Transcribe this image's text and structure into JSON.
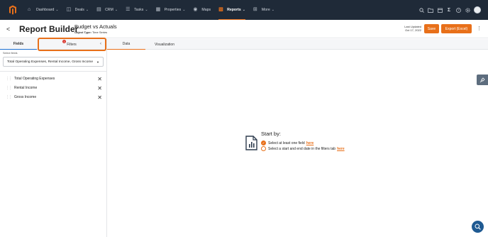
{
  "nav": {
    "items": [
      {
        "label": "Dashboard",
        "icon": "home-icon",
        "caret": true
      },
      {
        "label": "Deals",
        "icon": "deals-icon",
        "caret": true
      },
      {
        "label": "CRM",
        "icon": "crm-icon",
        "caret": true
      },
      {
        "label": "Tasks",
        "icon": "tasks-icon",
        "caret": true
      },
      {
        "label": "Properties",
        "icon": "properties-icon",
        "caret": true
      },
      {
        "label": "Maps",
        "icon": "maps-icon",
        "caret": false
      },
      {
        "label": "Reports",
        "icon": "reports-icon",
        "caret": true,
        "active": true
      },
      {
        "label": "More",
        "icon": "more-icon",
        "caret": true
      }
    ],
    "right_icons": [
      "search-icon",
      "folder-icon",
      "calendar-icon",
      "sigma-icon",
      "help-icon",
      "settings-icon",
      "user-avatar"
    ]
  },
  "header": {
    "back": "<",
    "title": "Report Builder",
    "subtitle": "Budget vs Actuals",
    "object_type_label": "Object Type:",
    "object_type_value": "Time Series",
    "last_updated_label": "Last Updated",
    "last_updated_value": "Oct 17, 2022",
    "save_label": "Save",
    "export_label": "Export (Excel)"
  },
  "left_panel": {
    "tabs": {
      "fields": "Fields",
      "filters": "Filters"
    },
    "filter_badge": "1",
    "select_label": "Select fields",
    "select_value": "Total Operating Expenses, Rental Income, Gross Income",
    "fields": [
      "Total Operating Expenses",
      "Rental Income",
      "Gross Income"
    ]
  },
  "right_panel": {
    "tabs": {
      "data": "Data",
      "visualization": "Visualization"
    },
    "empty_state": {
      "heading": "Start by:",
      "step1_text": "Select at least one field",
      "step1_link": "here",
      "step2_text": "Select a start and end date in the filters tab",
      "step2_link": "here"
    }
  },
  "colors": {
    "accent": "#e8701a",
    "nav_bg": "#1f2a38",
    "fab": "#1f5a92"
  }
}
